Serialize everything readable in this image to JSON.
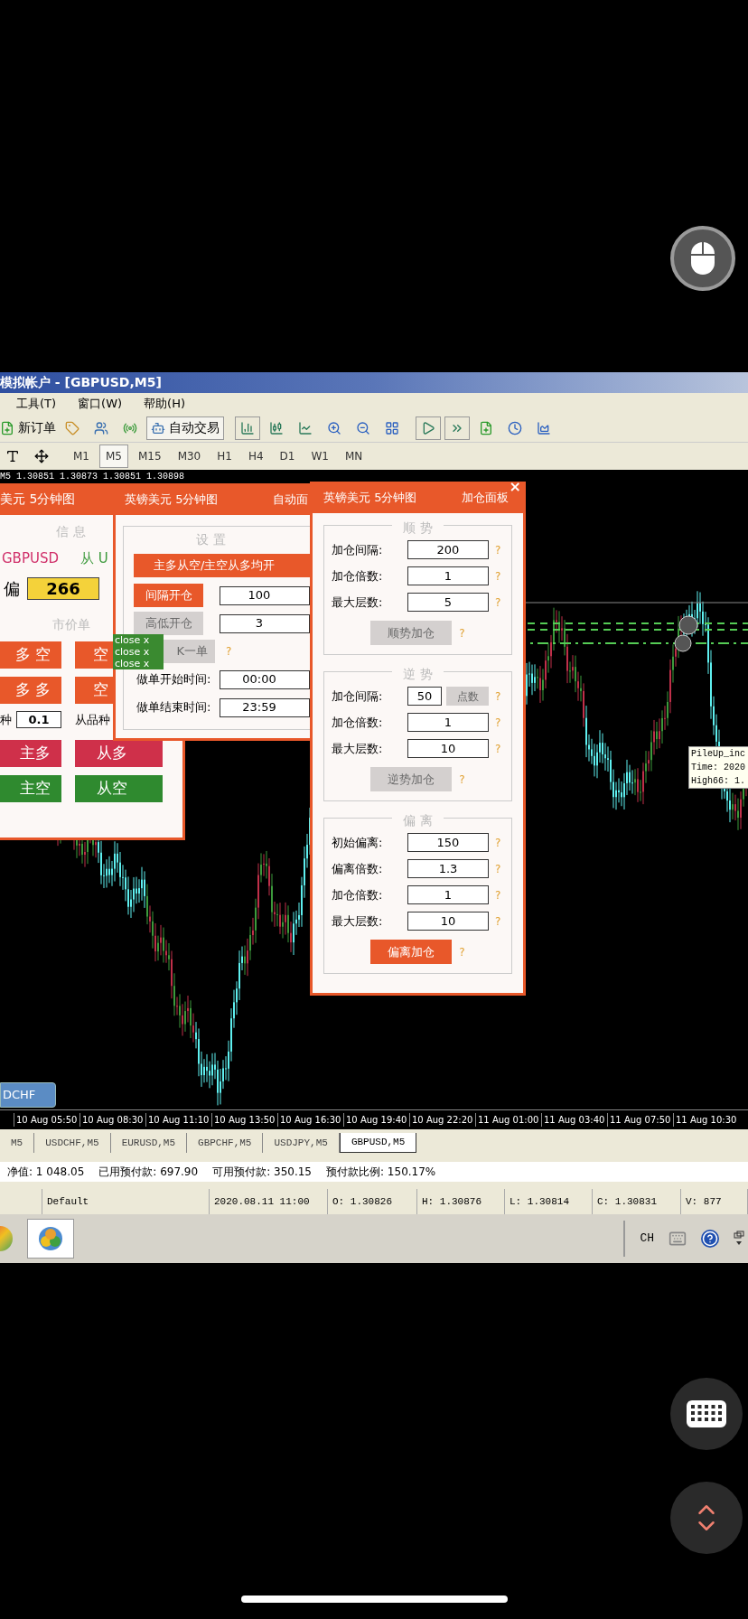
{
  "window": {
    "title": "模拟帐户 - [GBPUSD,M5]"
  },
  "menu": [
    "工具(T)",
    "窗口(W)",
    "帮助(H)"
  ],
  "toolbar": {
    "new_order": "新订单",
    "auto_trading": "自动交易"
  },
  "timeframes": [
    {
      "label": "M1",
      "selected": false
    },
    {
      "label": "M5",
      "selected": true
    },
    {
      "label": "M15",
      "selected": false
    },
    {
      "label": "M30",
      "selected": false
    },
    {
      "label": "H1",
      "selected": false
    },
    {
      "label": "H4",
      "selected": false
    },
    {
      "label": "D1",
      "selected": false
    },
    {
      "label": "W1",
      "selected": false
    },
    {
      "label": "MN",
      "selected": false
    }
  ],
  "chart": {
    "price_line": "M5  1.30851 1.30873 1.30851 1.30898",
    "symbol_button": "DCHF",
    "tooltip": [
      "PileUp_inc",
      "Time: 2020",
      "High66: 1."
    ],
    "time_axis": [
      "10 Aug 05:50",
      "10 Aug 08:30",
      "10 Aug 11:10",
      "10 Aug 13:50",
      "10 Aug 16:30",
      "10 Aug 19:40",
      "10 Aug 22:20",
      "11 Aug 01:00",
      "11 Aug 03:40",
      "11 Aug 07:50",
      "11 Aug 10:30"
    ]
  },
  "left_panel": {
    "title": "美元 5分钟图",
    "info_heading": "信 息",
    "main_symbol": "GBPUSD",
    "sub_symbol": "从 U",
    "deviation_label": "偏",
    "deviation": "266",
    "market_heading": "市价单",
    "top_buttons": [
      {
        "label": "多 空",
        "color": "#e8582a"
      },
      {
        "label": "空",
        "color": "#e8582a"
      },
      {
        "label": "多 多",
        "color": "#e8582a"
      },
      {
        "label": "空",
        "color": "#e8582a"
      }
    ],
    "lot_label": "种",
    "lot": "0.1",
    "sub_lot_label": "从品种",
    "bottom_buttons": [
      {
        "label": "主多",
        "color": "#cf304a"
      },
      {
        "label": "从多",
        "color": "#cf304a"
      },
      {
        "label": "主空",
        "color": "#2f8a2f"
      },
      {
        "label": "从空",
        "color": "#2f8a2f"
      }
    ]
  },
  "close_badges": [
    "close x",
    "close x",
    "close x"
  ],
  "mid_panel": {
    "title": "英镑美元 5分钟图",
    "tab": "自动面",
    "heading": "设 置",
    "main_button": {
      "label": "主多从空/主空从多均开",
      "disabled": false
    },
    "rows": [
      {
        "kind": "button",
        "label": "间隔开仓",
        "disabled": false,
        "value": "100"
      },
      {
        "kind": "button",
        "label": "高低开仓",
        "disabled": true,
        "value": "3"
      },
      {
        "kind": "button",
        "label": "K一单",
        "disabled": true,
        "help": "?"
      },
      {
        "kind": "field",
        "label": "做单开始时间:",
        "value": "00:00"
      },
      {
        "kind": "field",
        "label": "做单结束时间:",
        "value": "23:59"
      }
    ]
  },
  "right_panel": {
    "title": "英镑美元 5分钟图",
    "tab": "加仓面板",
    "close": "×",
    "sections": [
      {
        "heading": "顺 势",
        "rows": [
          {
            "label": "加仓间隔:",
            "value": "200",
            "help": "?"
          },
          {
            "label": "加仓倍数:",
            "value": "1",
            "help": "?"
          },
          {
            "label": "最大层数:",
            "value": "5",
            "help": "?"
          }
        ],
        "button": {
          "label": "顺势加仓",
          "disabled": true,
          "help": "?"
        }
      },
      {
        "heading": "逆 势",
        "rows": [
          {
            "label": "加仓间隔:",
            "value": "50",
            "unit_button": {
              "label": "点数",
              "disabled": true
            },
            "help": "?"
          },
          {
            "label": "加仓倍数:",
            "value": "1",
            "help": "?"
          },
          {
            "label": "最大层数:",
            "value": "10",
            "help": "?"
          }
        ],
        "button": {
          "label": "逆势加仓",
          "disabled": true,
          "help": "?"
        }
      },
      {
        "heading": "偏 离",
        "rows": [
          {
            "label": "初始偏离:",
            "value": "150",
            "help": "?"
          },
          {
            "label": "偏离倍数:",
            "value": "1.3",
            "help": "?"
          },
          {
            "label": "加仓倍数:",
            "value": "1",
            "help": "?"
          },
          {
            "label": "最大层数:",
            "value": "10",
            "help": "?"
          }
        ],
        "button": {
          "label": "偏离加仓",
          "disabled": false,
          "help": "?"
        }
      }
    ]
  },
  "chart_tabs": [
    {
      "label": "M5",
      "selected": false
    },
    {
      "label": "USDCHF,M5",
      "selected": false
    },
    {
      "label": "EURUSD,M5",
      "selected": false
    },
    {
      "label": "GBPCHF,M5",
      "selected": false
    },
    {
      "label": "USDJPY,M5",
      "selected": false
    },
    {
      "label": "GBPUSD,M5",
      "selected": true
    }
  ],
  "account": [
    "净值: 1 048.05",
    "已用预付款: 697.90",
    "可用预付款: 350.15",
    "预付款比例: 150.17%"
  ],
  "status_bar": [
    "Default",
    "2020.08.11 11:00",
    "O: 1.30826",
    "H: 1.30876",
    "L: 1.30814",
    "C: 1.30831",
    "V: 877"
  ],
  "taskbar": {
    "language": "CH"
  }
}
